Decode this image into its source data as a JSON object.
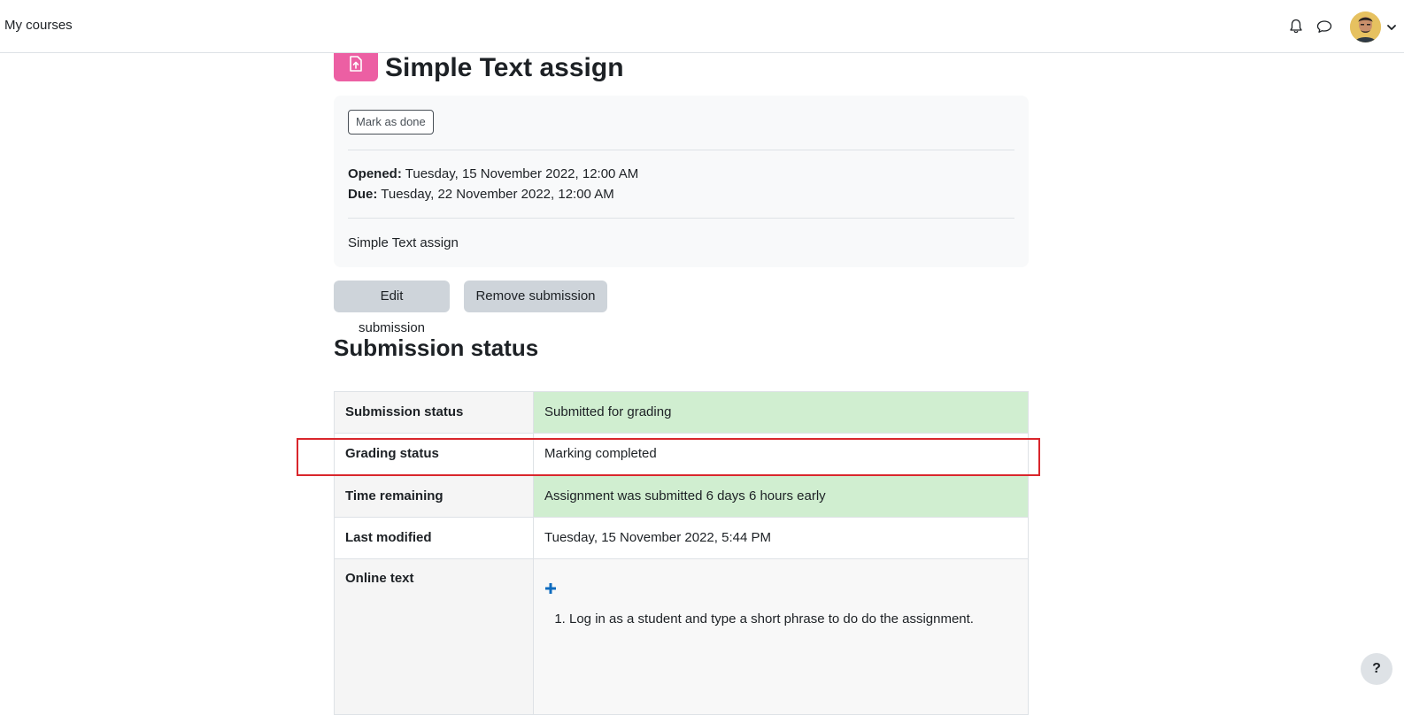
{
  "navbar": {
    "my_courses": "My courses",
    "icons": [
      "bell-icon",
      "chat-icon",
      "user-avatar",
      "chevron-down-icon"
    ]
  },
  "activity": {
    "icon": "assignment-icon",
    "icon_color": "#ec5fa3",
    "title": "Simple Text assign",
    "mark_done_label": "Mark as done",
    "opened_label": "Opened:",
    "opened_value": "Tuesday, 15 November 2022, 12:00 AM",
    "due_label": "Due:",
    "due_value": "Tuesday, 22 November 2022, 12:00 AM",
    "intro": "Simple Text assign"
  },
  "actions": {
    "edit_submission": "Edit submission",
    "remove_submission": "Remove submission"
  },
  "submission": {
    "heading": "Submission status",
    "rows": [
      {
        "label": "Submission status",
        "value": "Submitted for grading",
        "status_color": "#d0eed0"
      },
      {
        "label": "Grading status",
        "value": "Marking completed"
      },
      {
        "label": "Time remaining",
        "value": "Assignment was submitted 6 days 6 hours early",
        "status_color": "#d0eed0"
      },
      {
        "label": "Last modified",
        "value": "Tuesday, 15 November 2022, 5:44 PM"
      },
      {
        "label": "Online text",
        "list_items": [
          "Log in as a student and type a short phrase to do do the assignment."
        ]
      }
    ]
  },
  "help": {
    "label": "?"
  },
  "colors": {
    "accent_highlight": "#d9262c",
    "success_bg": "#d0eed0",
    "link_blue": "#0f6cbf"
  }
}
